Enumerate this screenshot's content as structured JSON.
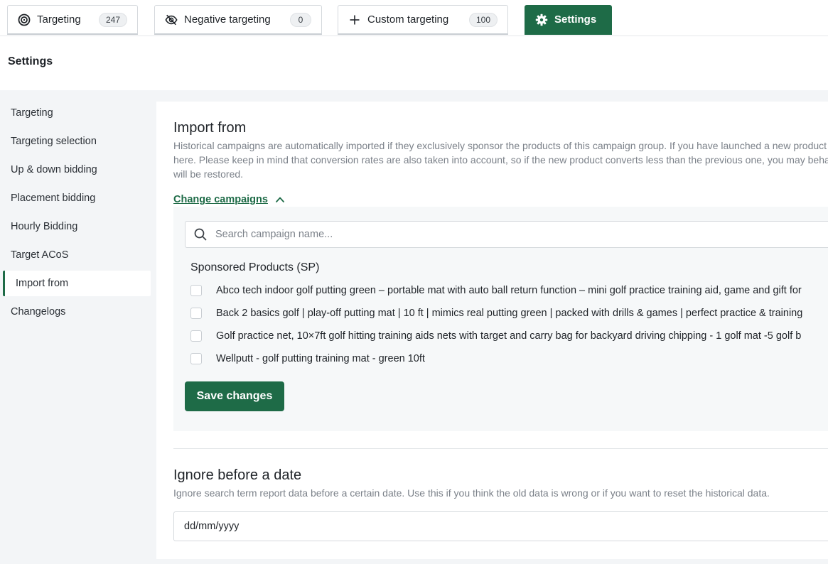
{
  "tabs": [
    {
      "label": "Targeting",
      "count": "247",
      "icon": "target-icon",
      "active": false
    },
    {
      "label": "Negative targeting",
      "count": "0",
      "icon": "eye-off-icon",
      "active": false
    },
    {
      "label": "Custom targeting",
      "count": "100",
      "icon": "plus-icon",
      "active": false
    },
    {
      "label": "Settings",
      "icon": "gear-icon",
      "active": true
    }
  ],
  "header": {
    "title": "Settings"
  },
  "sidebar": {
    "items": [
      {
        "label": "Targeting"
      },
      {
        "label": "Targeting selection"
      },
      {
        "label": "Up & down bidding"
      },
      {
        "label": "Placement bidding"
      },
      {
        "label": "Hourly Bidding"
      },
      {
        "label": "Target ACoS"
      },
      {
        "label": "Import from",
        "active": true
      },
      {
        "label": "Changelogs"
      }
    ]
  },
  "import_from": {
    "title": "Import from",
    "description": "Historical campaigns are automatically imported if they exclusively sponsor the products of this campaign group. If you have launched a new product here. Please keep in mind that conversion rates are also taken into account, so if the new product converts less than the previous one, you may behavior will be restored.",
    "change_link": "Change campaigns",
    "search_placeholder": "Search campaign name...",
    "group_title": "Sponsored Products (SP)",
    "campaigns": [
      {
        "label": "Abco tech indoor golf putting green – portable mat with auto ball return function – mini golf practice training aid, game and gift for"
      },
      {
        "label": "Back 2 basics golf | play-off putting mat | 10 ft | mimics real putting green | packed with drills & games | perfect practice & training"
      },
      {
        "label": "Golf practice net, 10×7ft golf hitting training aids nets with target and carry bag for backyard driving chipping - 1 golf mat -5 golf b"
      },
      {
        "label": "Wellputt - golf putting training mat - green 10ft"
      }
    ],
    "save_label": "Save changes"
  },
  "ignore_before": {
    "title": "Ignore before a date",
    "description": "Ignore search term report data before a certain date. Use this if you think the old data is wrong or if you want to reset the historical data.",
    "date_placeholder": "dd/mm/yyyy"
  },
  "colors": {
    "accent": "#1e6b47",
    "background": "#f3f5f7"
  }
}
